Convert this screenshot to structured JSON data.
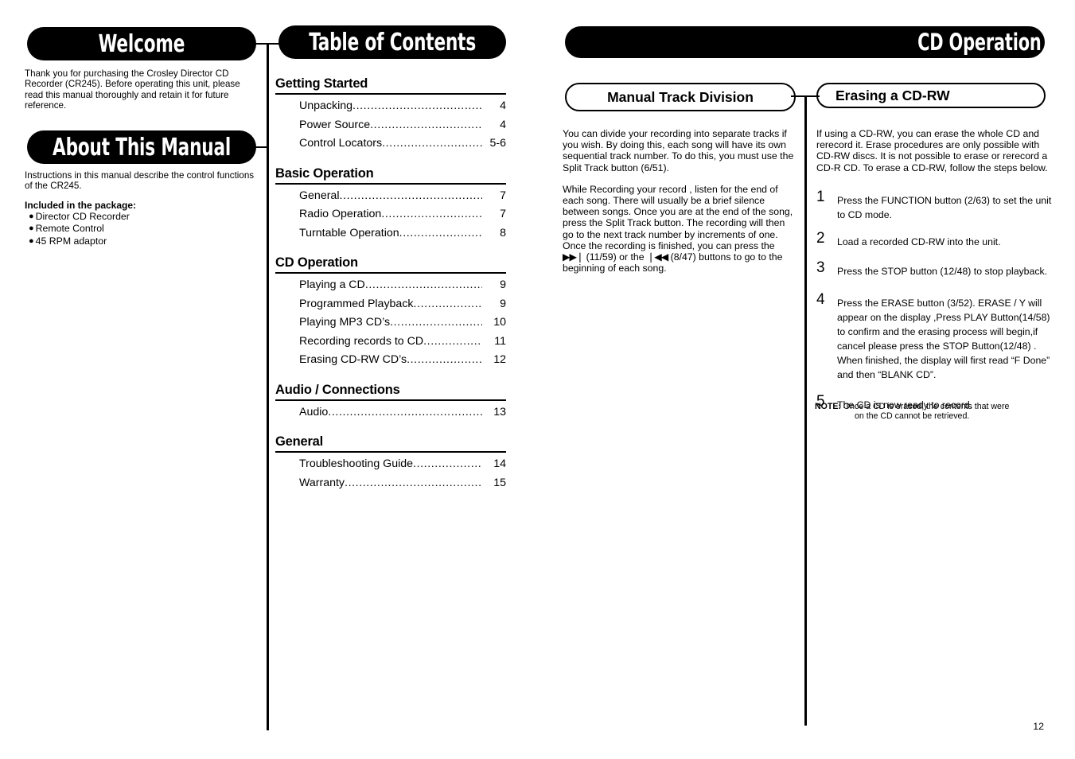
{
  "page_number": "12",
  "left_column": {
    "welcome_header": "Welcome",
    "welcome_text": "Thank you for purchasing the Crosley Director CD Recorder (CR245). Before operating this unit, please read this manual thoroughly and retain it for future reference.",
    "about_header": "About This Manual",
    "about_text": "Instructions in this manual describe the control functions of the CR245.",
    "package_title": "Included in the package:",
    "package_items": [
      "Director CD Recorder",
      "Remote Control",
      "45 RPM adaptor"
    ]
  },
  "toc": {
    "header": "Table of Contents",
    "sections": [
      {
        "title": "Getting Started",
        "entries": [
          {
            "label": "Unpacking",
            "page": "4"
          },
          {
            "label": "Power Source",
            "page": "4"
          },
          {
            "label": "Control Locators",
            "page": "5-6"
          }
        ]
      },
      {
        "title": "Basic Operation",
        "entries": [
          {
            "label": "General",
            "page": "7"
          },
          {
            "label": "Radio Operation",
            "page": "7"
          },
          {
            "label": "Turntable Operation",
            "page": "8"
          }
        ]
      },
      {
        "title": "CD Operation",
        "entries": [
          {
            "label": "Playing  a CD",
            "page": "9"
          },
          {
            "label": "Programmed Playback",
            "page": "9"
          },
          {
            "label": "Playing MP3 CD’s",
            "page": "10"
          },
          {
            "label": "Recording records to CD",
            "page": "11"
          },
          {
            "label": "Erasing CD-RW CD’s",
            "page": "12"
          }
        ]
      },
      {
        "title": "Audio / Connections",
        "entries": [
          {
            "label": "Audio",
            "page": "13"
          }
        ]
      },
      {
        "title": "General",
        "entries": [
          {
            "label": "Troubleshooting Guide",
            "page": "14"
          },
          {
            "label": "Warranty",
            "page": "15"
          }
        ]
      }
    ]
  },
  "right_page": {
    "header": "CD Operation",
    "manual_track": {
      "header": "Manual Track Division",
      "paragraph_1": "You can divide your recording into separate tracks if you wish. By doing this, each song will have its own sequential track number. To do this, you must use the Split Track button (6/51).",
      "paragraph_2_part1": "While Recording your record , listen for the end of each song. There will usually be a brief silence between songs. Once you are at the end of the song, press the Split Track button. The recording will then go to the next track number by increments of one. Once the recording is finished, you can press the ",
      "next_icon": "▶▶❘",
      "paragraph_2_part2": " (11/59) or the ",
      "prev_icon": "❘◀◀",
      "paragraph_2_part3": " (8/47) buttons to go to the beginning of each song."
    },
    "erasing": {
      "header": "Erasing a CD-RW",
      "intro": "If using a CD-RW, you can erase the whole CD and rerecord it. Erase procedures are only possible with CD-RW discs. It is not possible to erase or rerecord a CD-R CD. To erase a CD-RW, follow the steps below.",
      "steps": [
        {
          "number": "1",
          "text": "Press the FUNCTION button (2/63) to set the unit to CD mode."
        },
        {
          "number": "2",
          "text": "Load a recorded CD-RW into the unit."
        },
        {
          "number": "3",
          "text": "Press the STOP button (12/48) to stop playback."
        },
        {
          "number": "4",
          "text": "Press the ERASE button (3/52). ERASE / Y will appear on the display ,Press PLAY Button(14/58) to confirm and the erasing process will begin,if cancel please press the STOP Button(12/48) . When finished, the display will first read “F Done” and then “BLANK CD”."
        },
        {
          "number": "5",
          "text": "The CD is now ready to record."
        }
      ],
      "note_label": "NOTE:",
      "note_line1": "Once a CD is erased, the contents that were",
      "note_line2": "on the CD cannot be retrieved."
    }
  },
  "colors": {
    "ink": "#000000",
    "paper": "#ffffff"
  }
}
